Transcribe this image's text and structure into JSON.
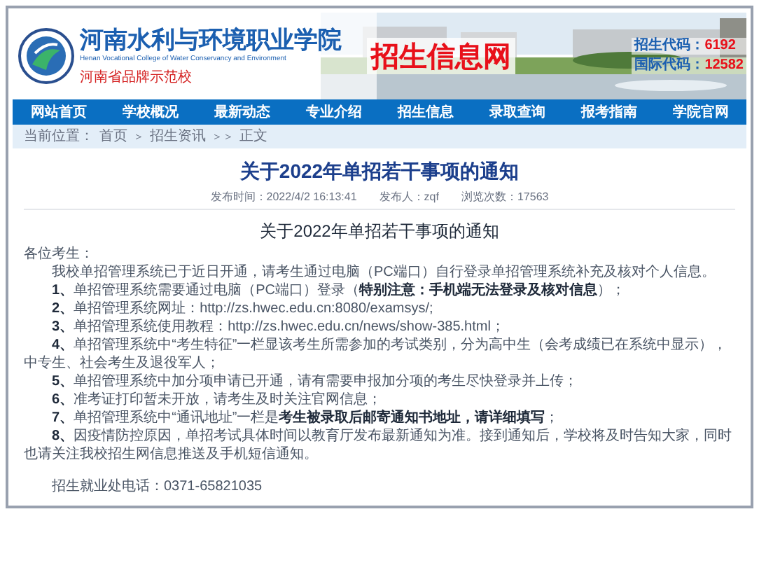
{
  "header": {
    "school_name": "河南水利与环境职业学院",
    "school_name_en": "Henan Vocational College of Water Conservancy and Environment",
    "motto": "河南省品牌示范校",
    "site_title": "招生信息网",
    "codes": [
      {
        "label": "招生代码：",
        "value": "6192"
      },
      {
        "label": "国际代码：",
        "value": "12582"
      }
    ]
  },
  "nav": [
    {
      "label": "网站首页"
    },
    {
      "label": "学校概况"
    },
    {
      "label": "最新动态"
    },
    {
      "label": "专业介绍"
    },
    {
      "label": "招生信息"
    },
    {
      "label": "录取查询"
    },
    {
      "label": "报考指南"
    },
    {
      "label": "学院官网"
    }
  ],
  "breadcrumb": {
    "prefix": "当前位置：",
    "items": [
      {
        "label": "首页",
        "kind": "link"
      },
      {
        "label": "＞",
        "kind": "sep"
      },
      {
        "label": "招生资讯",
        "kind": "link"
      },
      {
        "label": "＞＞",
        "kind": "sep"
      },
      {
        "label": "正文",
        "kind": "text"
      }
    ]
  },
  "article": {
    "title": "关于2022年单招若干事项的通知",
    "meta": [
      "发布时间：2022/4/2 16:13:41",
      "发布人：zqf",
      "浏览次数：17563"
    ],
    "heading": "关于2022年单招若干事项的通知",
    "greeting": "各位考生：",
    "intro": "我校单招管理系统已于近日开通，请考生通过电脑（PC端口）自行登录单招管理系统补充及核对个人信息。",
    "items": [
      {
        "number": "1、",
        "text": "单招管理系统需要通过电脑（PC端口）登录（**特别注意：手机端无法登录及核对信息**）；"
      },
      {
        "number": "2、",
        "text": "单招管理系统网址：http://zs.hwec.edu.cn:8080/examsys/;"
      },
      {
        "number": "3、",
        "text": "单招管理系统使用教程：http://zs.hwec.edu.cn/news/show-385.html；"
      },
      {
        "number": "4、",
        "text": "单招管理系统中“考生特征”一栏显该考生所需参加的考试类别，分为高中生（会考成绩已在系统中显示），中专生、社会考生及退役军人；"
      },
      {
        "number": "5、",
        "text": "单招管理系统中加分项申请已开通，请有需要申报加分项的考生尽快登录并上传；"
      },
      {
        "number": "6、",
        "text": "准考证打印暂未开放，请考生及时关注官网信息；"
      },
      {
        "number": "7、",
        "text": "单招管理系统中“通讯地址”一栏是**考生被录取后邮寄通知书地址，请详细填写**；"
      },
      {
        "number": "8、",
        "text": "因疫情防控原因，单招考试具体时间以教育厅发布最新通知为准。接到通知后，学校将及时告知大家，同时也请关注我校招生网信息推送及手机短信通知。"
      }
    ],
    "contact": "招生就业处电话：0371-65821035"
  }
}
